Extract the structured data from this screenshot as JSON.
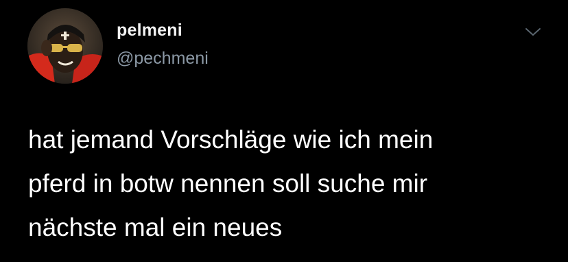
{
  "tweet": {
    "author": {
      "display_name": "pelmeni",
      "handle": "@pechmeni",
      "avatar_icon": "profile-photo"
    },
    "menu_icon": "chevron-down-icon",
    "text_lines": [
      "hat jemand Vorschläge wie ich mein",
      "pferd in botw nennen soll suche mir",
      "nächste mal ein neues"
    ]
  },
  "colors": {
    "background": "#000000",
    "text": "#ffffff",
    "secondary_text": "#8b98a5",
    "avatar_accent": "#d42a1c"
  }
}
